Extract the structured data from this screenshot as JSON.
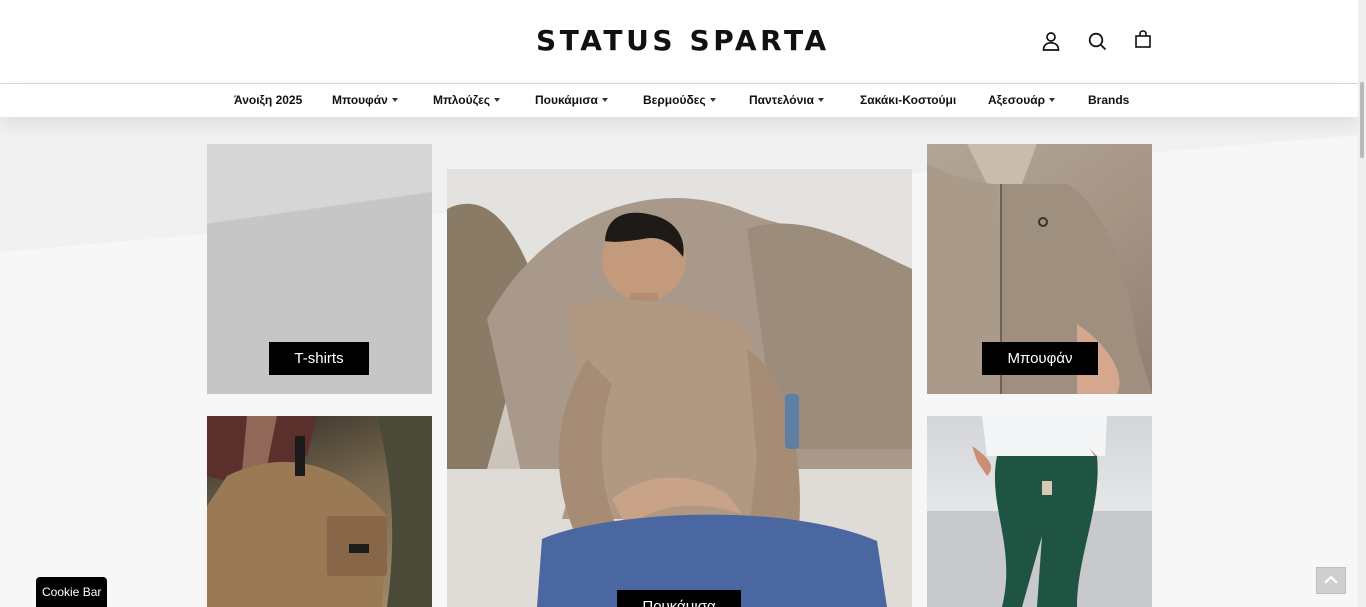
{
  "header": {
    "logo": "STATUS SPARTA",
    "icons": [
      "user-icon",
      "search-icon",
      "shopping-bag-icon"
    ]
  },
  "nav": {
    "items": [
      {
        "label": "Άνοιξη 2025",
        "dropdown": false
      },
      {
        "label": "Μπουφάν",
        "dropdown": true
      },
      {
        "label": "Μπλούζες",
        "dropdown": true
      },
      {
        "label": "Πουκάμισα",
        "dropdown": true
      },
      {
        "label": "Βερμούδες",
        "dropdown": true
      },
      {
        "label": "Παντελόνια",
        "dropdown": true
      },
      {
        "label": "Σακάκι-Κοστούμι",
        "dropdown": false
      },
      {
        "label": "Αξεσουάρ",
        "dropdown": true
      },
      {
        "label": "Brands",
        "dropdown": false
      }
    ]
  },
  "tiles": [
    {
      "label": "T-shirts"
    },
    {
      "label": "Πουκάμισα"
    },
    {
      "label": "Μπουφάν"
    },
    {
      "label": ""
    },
    {
      "label": ""
    }
  ],
  "cookie_bar": {
    "label": "Cookie Bar"
  },
  "colors": {
    "label_bg": "#000000",
    "label_text": "#ffffff",
    "header_bg": "#ffffff"
  }
}
